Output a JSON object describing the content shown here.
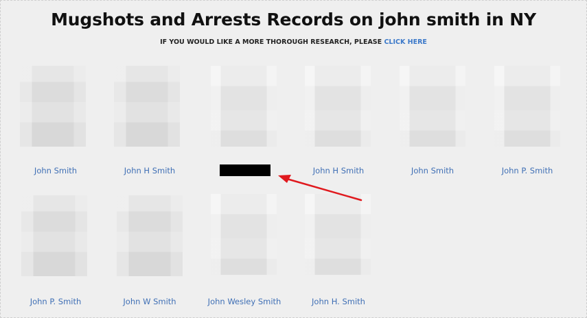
{
  "header": {
    "title": "Mugshots and Arrests Records on john smith in NY",
    "subtitle_text": "IF YOU WOULD LIKE A MORE THOROUGH RESEARCH, PLEASE",
    "subtitle_link": "CLICK HERE"
  },
  "results": {
    "row1": [
      "John Smith",
      "John H Smith",
      "",
      "John H Smith",
      "John Smith",
      "John P. Smith"
    ],
    "row2": [
      "John P. Smith",
      "John W Smith",
      "John Wesley Smith",
      "John H. Smith"
    ]
  },
  "annotation": {
    "arrow_color": "#e0191e"
  }
}
